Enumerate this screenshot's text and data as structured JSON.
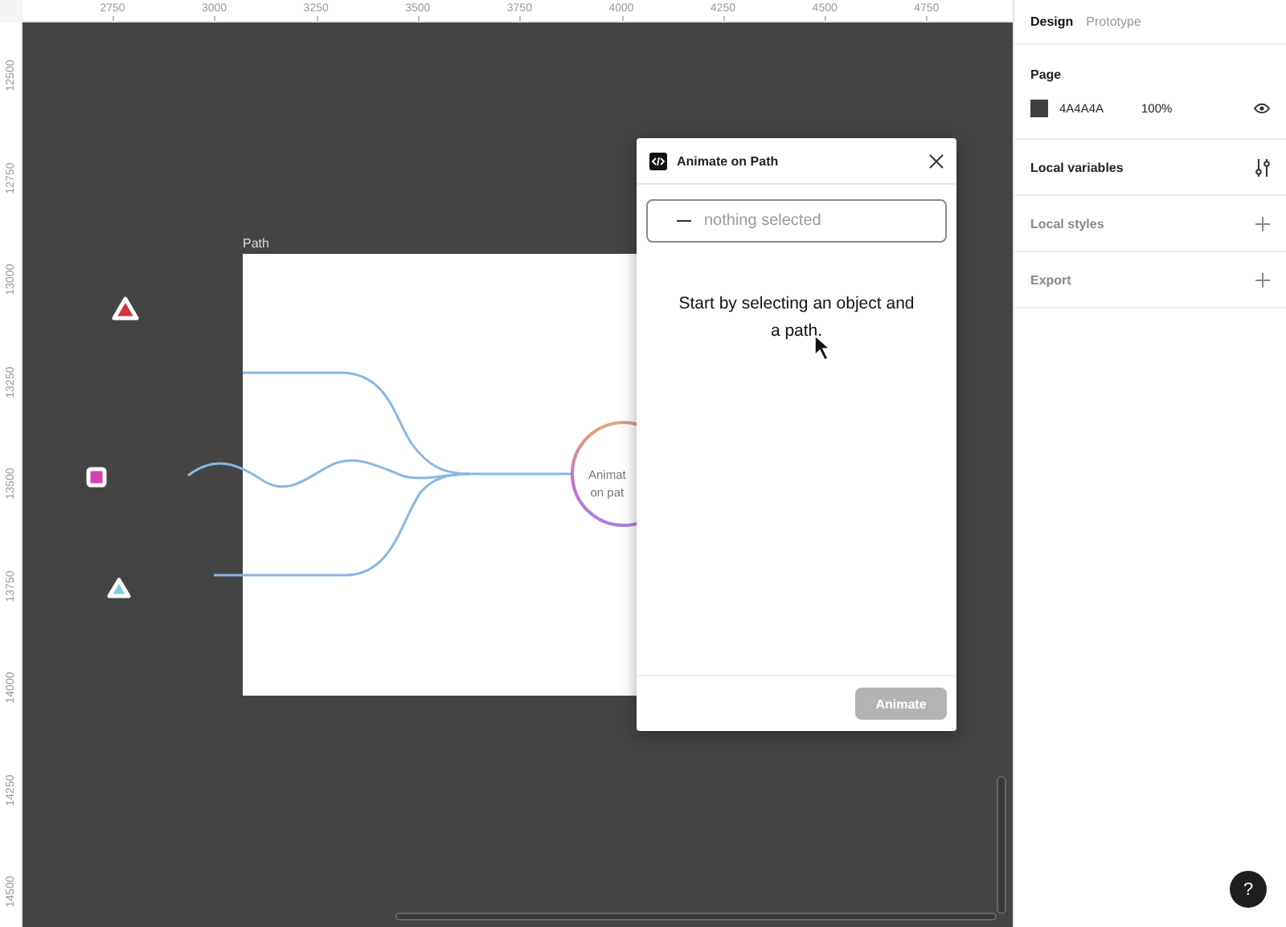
{
  "rulers": {
    "horizontal": [
      "2750",
      "3000",
      "3250",
      "3500",
      "3750",
      "4000",
      "4250",
      "4500",
      "4750"
    ],
    "vertical": [
      "12500",
      "12750",
      "13000",
      "13250",
      "13500",
      "13750",
      "14000",
      "14250",
      "14500"
    ]
  },
  "canvas": {
    "frame": {
      "name": "Path",
      "node_text": [
        "Animat",
        "on pat"
      ]
    }
  },
  "plugin": {
    "title": "Animate on Path",
    "selection": "nothing selected",
    "message": "Start by selecting an object and a path.",
    "button": {
      "label": "Animate",
      "disabled": true
    }
  },
  "sidebar": {
    "tabs": [
      {
        "label": "Design",
        "selected": true
      },
      {
        "label": "Prototype",
        "selected": false
      }
    ],
    "page": {
      "title": "Page",
      "fill": "4A4A4A",
      "opacity": "100%"
    },
    "sections": [
      {
        "label": "Local variables",
        "kind": "variables"
      },
      {
        "label": "Local styles",
        "kind": "add"
      },
      {
        "label": "Export",
        "kind": "add"
      }
    ]
  },
  "help": "?"
}
